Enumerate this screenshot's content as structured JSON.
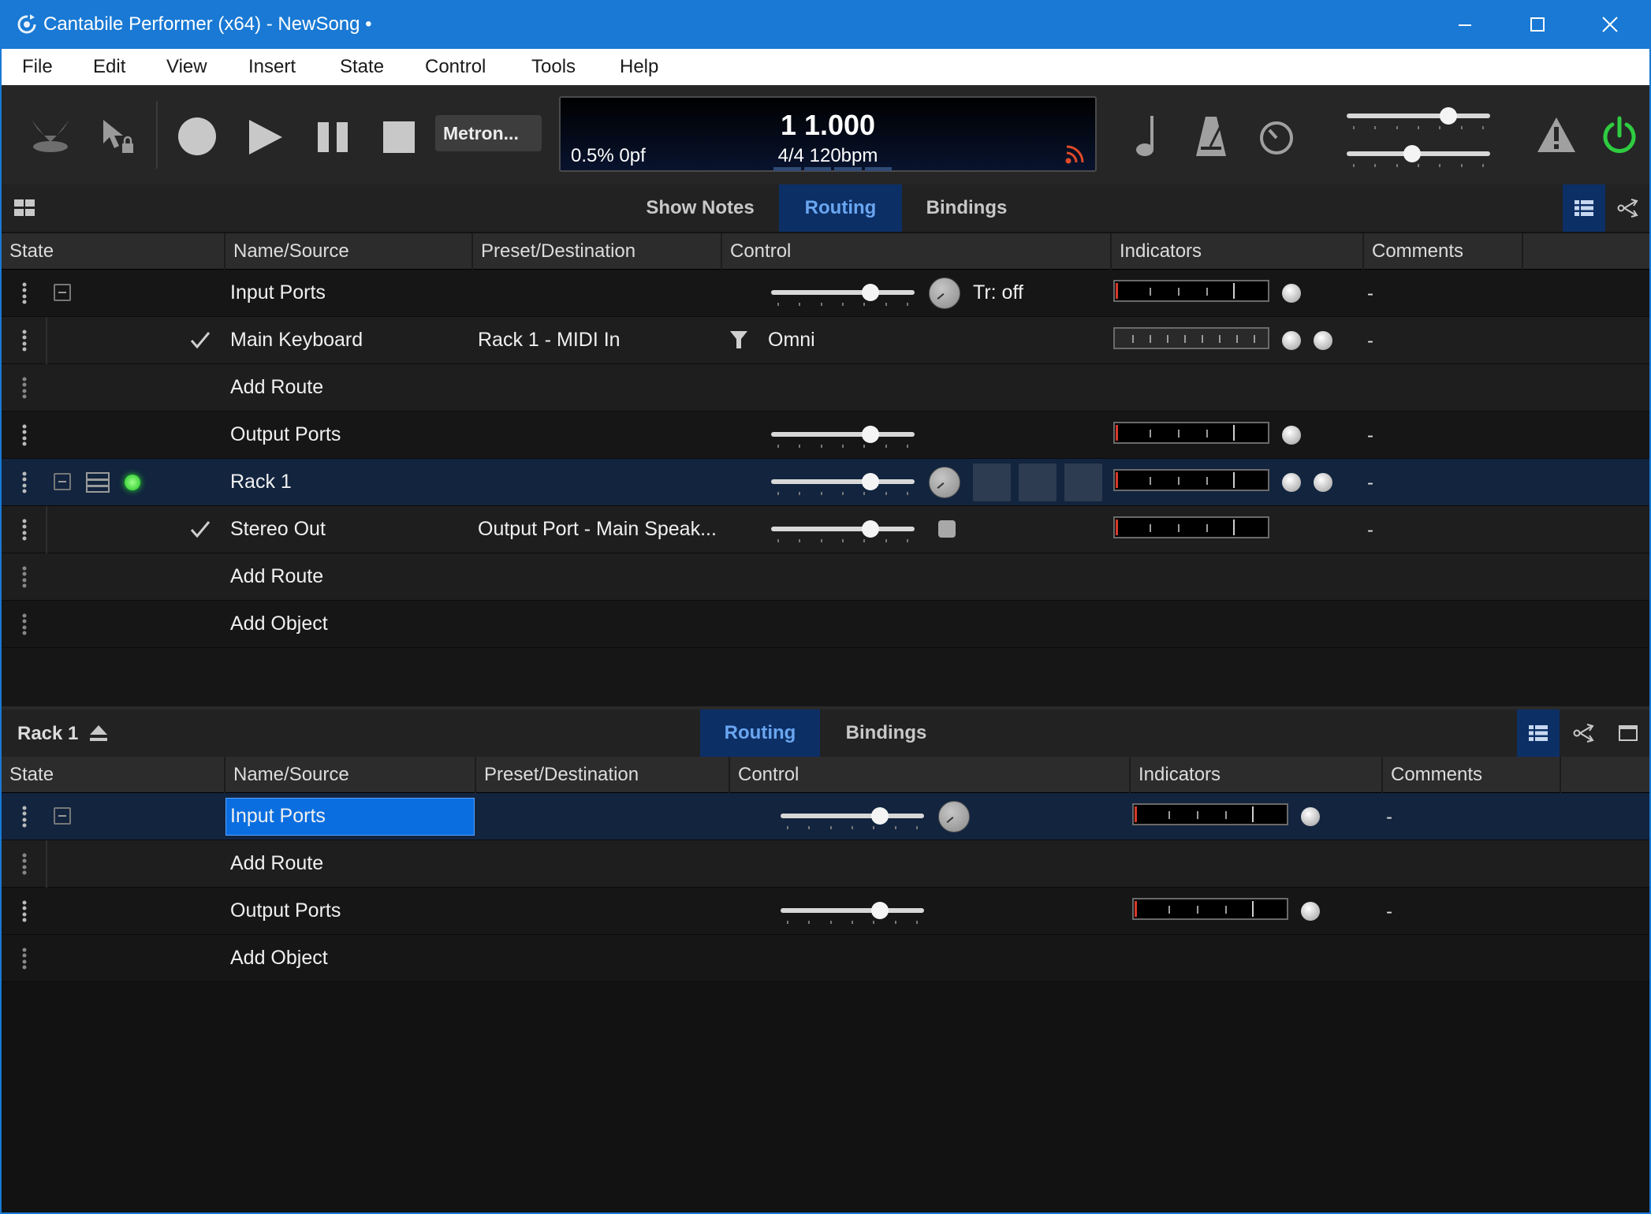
{
  "window": {
    "title": "Cantabile Performer (x64) - NewSong •",
    "accent_color": "#1979d4"
  },
  "menu": [
    "File",
    "Edit",
    "View",
    "Insert",
    "State",
    "Control",
    "Tools",
    "Help"
  ],
  "toolbar": {
    "metronome_label": "Metron...",
    "transport": {
      "position": "1 1.000",
      "load": "0.5%  0pf",
      "tempo": "4/4 120bpm"
    },
    "power_color": "#2ecc40",
    "master_sliders": [
      0.74,
      0.45
    ]
  },
  "top_panel": {
    "tabs": [
      "Show Notes",
      "Routing",
      "Bindings"
    ],
    "active_tab": "Routing",
    "columns": [
      "State",
      "Name/Source",
      "Preset/Destination",
      "Control",
      "Indicators",
      "Comments"
    ],
    "rows": [
      {
        "name": "Input Ports",
        "destination": "",
        "control_text": "Tr: off",
        "comment": "-",
        "slider_value": 0.72
      },
      {
        "name": "Main Keyboard",
        "destination": "Rack 1 - MIDI In",
        "control_text": "Omni",
        "comment": "-"
      },
      {
        "name": "Add Route"
      },
      {
        "name": "Output Ports",
        "comment": "-",
        "slider_value": 0.72
      },
      {
        "name": "Rack 1",
        "comment": "-",
        "slider_value": 0.72
      },
      {
        "name": "Stereo Out",
        "destination": "Output Port - Main Speak...",
        "comment": "-",
        "slider_value": 0.72
      },
      {
        "name": "Add Route"
      },
      {
        "name": "Add Object"
      }
    ]
  },
  "bottom_panel": {
    "title": "Rack 1",
    "tabs": [
      "Routing",
      "Bindings"
    ],
    "active_tab": "Routing",
    "columns": [
      "State",
      "Name/Source",
      "Preset/Destination",
      "Control",
      "Indicators",
      "Comments"
    ],
    "rows": [
      {
        "name": "Input Ports",
        "comment": "-",
        "slider_value": 0.72
      },
      {
        "name": "Add Route"
      },
      {
        "name": "Output Ports",
        "comment": "-",
        "slider_value": 0.72
      },
      {
        "name": "Add Object"
      }
    ]
  }
}
